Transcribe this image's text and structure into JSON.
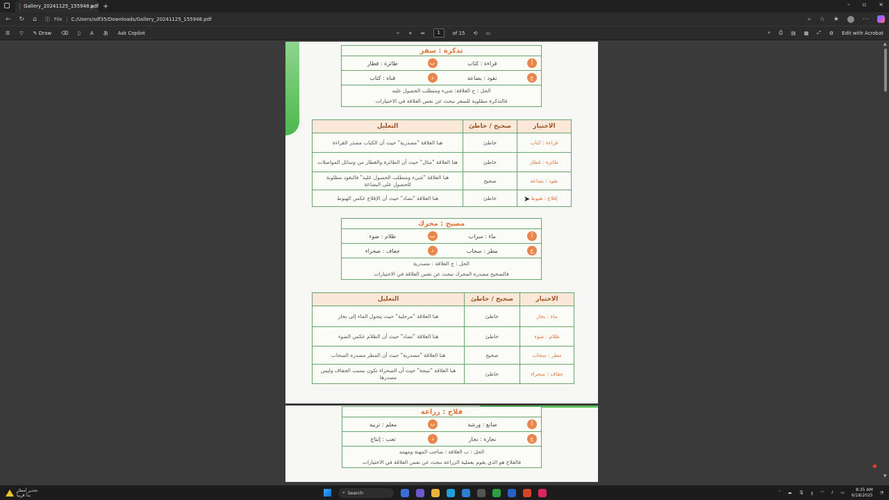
{
  "browser": {
    "tab_title": "Gallery_20241125_155948.pdf",
    "tab_close": "×",
    "new_tab": "+",
    "file_label": "File",
    "url": "C:/Users/sdf35/Downloads/Gallery_20241125_155948.pdf",
    "win_min": "–",
    "win_max": "▫",
    "win_close": "×"
  },
  "pdf_toolbar": {
    "draw_label": "Draw",
    "ask_copilot_label": "Ask Copilot",
    "zoom_out": "−",
    "zoom_in": "+",
    "page_current": "1",
    "page_total": "of 15",
    "edit_acrobat_label": "Edit with Acrobat"
  },
  "page1": {
    "box1": {
      "title": "تذكرة : سفر",
      "row1": {
        "a_badge": "أ",
        "a_text": "قراءة : كتاب",
        "b_badge": "ب",
        "b_text": "طائرة : قطار"
      },
      "row2": {
        "c_badge": "ج",
        "c_text": "نقود : بضاعة",
        "d_badge": "د",
        "d_text": "قناة : كتاب"
      },
      "note1": "الحل : ج          العلاقة: شيء ومتطلب الحصول عليه",
      "note2": "فالتذكرة مطلوبة للسفر نبحث عن نفس العلاقة في الاختيارات"
    },
    "table1": {
      "headers": [
        "الاختيار",
        "صحيح / خاطئ",
        "التعليل"
      ],
      "rows": [
        {
          "option": "قراءة : كتاب",
          "status": "خاطئ",
          "reason": "هنا العلاقة \"مصدرية\" حيث أن الكتاب مصدر القراءة"
        },
        {
          "option": "طائرة : قطار",
          "status": "خاطئ",
          "reason": "هنا العلاقة \"مثال\" حيث أن الطائرة والقطار من وسائل المواصلات"
        },
        {
          "option": "نقود : بضاعة",
          "status": "صحيح",
          "reason": "هنا العلاقة \"شيء ومتطلب الحصول عليه\" فالنقود مطلوبة للحصول على البضاعة"
        },
        {
          "option": "إقلاع : هبوط",
          "status": "خاطئ",
          "reason": "هنا العلاقة \"تضاد\" حيث أن الإقلاع عكس الهبوط"
        }
      ]
    },
    "box2": {
      "title": "مصيح : محرك",
      "row1": {
        "a_badge": "أ",
        "a_text": "ماء : سراب",
        "b_badge": "ب",
        "b_text": "ظلام : ضوء"
      },
      "row2": {
        "c_badge": "ج",
        "c_text": "مطر : سحاب",
        "d_badge": "د",
        "d_text": "جفاف : صحراء"
      },
      "note1": "الحل : ج          العلاقة : مصدرية",
      "note2": "فالصحيح مصدره المحرك نبحث عن نفس العلاقة في الاختيارات"
    },
    "table2": {
      "headers": [
        "الاختيار",
        "صحيح / خاطئ",
        "التعليل"
      ],
      "rows": [
        {
          "option": "ماء : بخار",
          "status": "خاطئ",
          "reason": "هنا العلاقة \"مرحلية\" حيث يتحول الماء إلى بخار"
        },
        {
          "option": "ظلام : ضوء",
          "status": "خاطئ",
          "reason": "هنا العلاقة \"تضاد\" حيث أن الظلام عكس الضوء"
        },
        {
          "option": "مطر : سحاب",
          "status": "صحيح",
          "reason": "هنا العلاقة \"مصدرية\" حيث أن المطر مصدره السحاب"
        },
        {
          "option": "جفاف : صحراء",
          "status": "خاطئ",
          "reason": "هنا العلاقة \"نتيجة\" حيث أن الصحراء تكون بسبب الجفاف وليس مصدرها"
        }
      ]
    }
  },
  "page2": {
    "box3": {
      "title": "فلاح : زراعة",
      "row1": {
        "a_badge": "أ",
        "a_text": "صانع : ورشة",
        "b_badge": "ب",
        "b_text": "معلم : تربية"
      },
      "row2": {
        "c_badge": "ج",
        "c_text": "نجارة : نجار",
        "d_badge": "د",
        "d_text": "تعب : إنتاج"
      },
      "note1": "الحل : ب          العلاقة : صاحب المهنة ومهنته",
      "note2": "فالفلاح هو الذي يقوم بعملية الزراعة نبحث عن نفس العلاقة في الاختيارات"
    }
  },
  "taskbar": {
    "weather_line1": "تحذير أمطار",
    "weather_line2": "بدأ قريباً",
    "search_label": "Search",
    "lang": "ع",
    "time": "8:35 AM",
    "date": "6/18/2025"
  }
}
